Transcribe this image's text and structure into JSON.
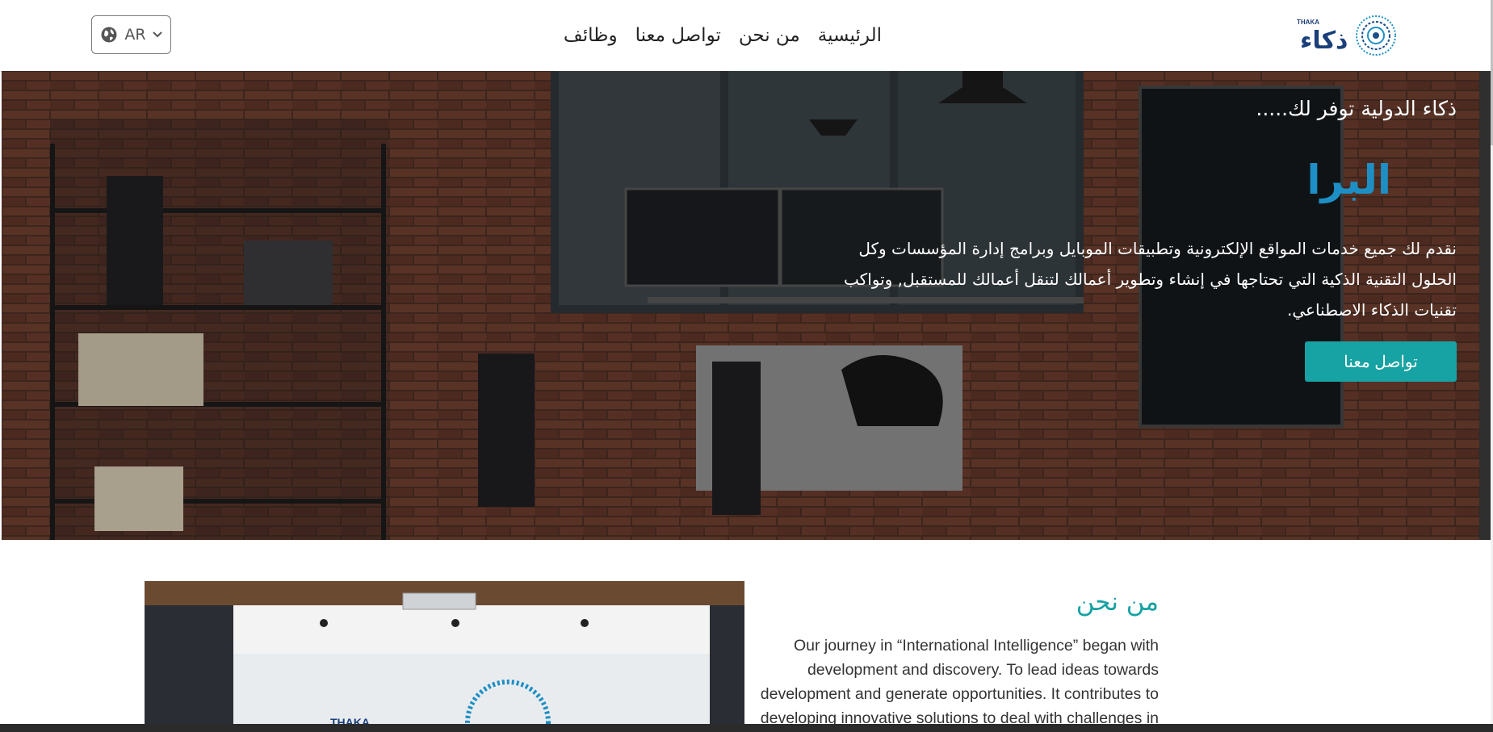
{
  "header": {
    "language": "AR",
    "nav": [
      "الرئيسية",
      "من نحن",
      "تواصل معنا",
      "وظائف"
    ],
    "logo": {
      "arabic": "ذكاء",
      "english": "THAKA"
    }
  },
  "hero": {
    "kicker": "ذكاء الدولية توفر لك.....",
    "typed_word": "البرا",
    "description": "نقدم لك جميع خدمات المواقع الإلكترونية وتطبيقات الموبايل وبرامج إدارة المؤسسات وكل الحلول التقنية الذكية التي تحتاجها في إنشاء وتطوير أعمالك لتنقل أعمالك للمستقبل, وتواكب تقنيات الذكاء الاصطناعي.",
    "cta": "تواصل معنا",
    "accent": "#17a2a3"
  },
  "about": {
    "title": "من نحن",
    "text": "Our journey in “International Intelligence” began with development and discovery. To lead ideas towards development and generate opportunities. It contributes to developing innovative solutions to deal with challenges in"
  }
}
